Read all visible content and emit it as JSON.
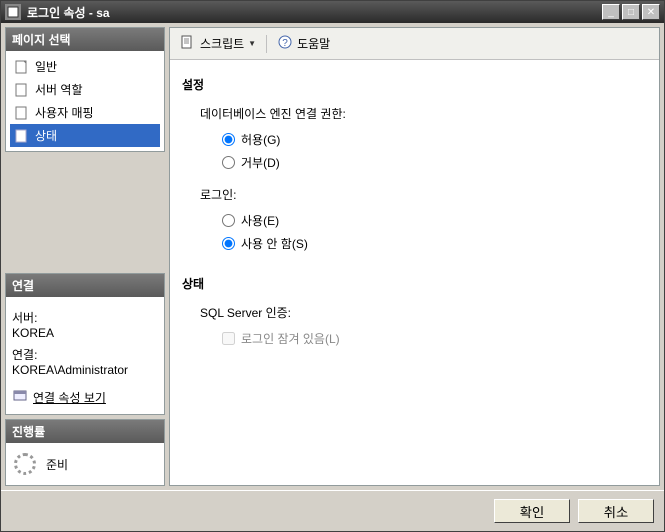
{
  "titlebar": {
    "text": "로그인 속성 - sa"
  },
  "sidebar": {
    "page_select_header": "페이지 선택",
    "nav": [
      {
        "label": "일반"
      },
      {
        "label": "서버 역할"
      },
      {
        "label": "사용자 매핑"
      },
      {
        "label": "상태"
      }
    ],
    "connection_header": "연결",
    "server_label": "서버:",
    "server_value": "KOREA",
    "conn_label": "연결:",
    "conn_value": "KOREA\\Administrator",
    "view_conn_props": "연결 속성 보기",
    "progress_header": "진행률",
    "progress_status": "준비"
  },
  "toolbar": {
    "script": "스크립트",
    "help": "도움말"
  },
  "content": {
    "settings": "설정",
    "db_engine_perm": "데이터베이스 엔진 연결 권한:",
    "grant": "허용(G)",
    "deny": "거부(D)",
    "login": "로그인:",
    "enable": "사용(E)",
    "disable": "사용 안 함(S)",
    "status": "상태",
    "sql_auth": "SQL Server 인증:",
    "locked_out": "로그인 잠겨 있음(L)"
  },
  "footer": {
    "ok": "확인",
    "cancel": "취소"
  }
}
